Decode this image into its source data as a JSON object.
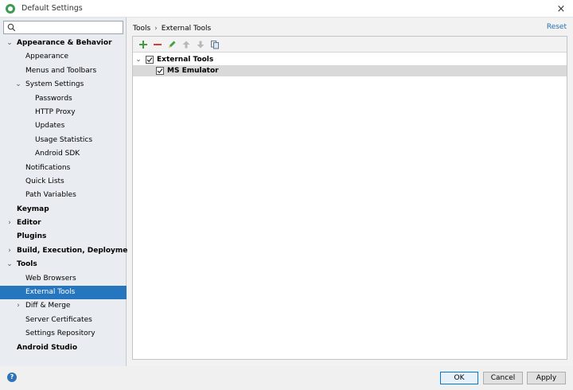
{
  "window": {
    "title": "Default Settings",
    "close_glyph": "×"
  },
  "search": {
    "value": "",
    "placeholder": ""
  },
  "sidebar": {
    "items": [
      {
        "label": "Appearance & Behavior",
        "level": 0,
        "bold": true,
        "arrow": "expanded"
      },
      {
        "label": "Appearance",
        "level": 2
      },
      {
        "label": "Menus and Toolbars",
        "level": 2
      },
      {
        "label": "System Settings",
        "level": 1,
        "arrow": "expanded"
      },
      {
        "label": "Passwords",
        "level": 3
      },
      {
        "label": "HTTP Proxy",
        "level": 3
      },
      {
        "label": "Updates",
        "level": 3
      },
      {
        "label": "Usage Statistics",
        "level": 3
      },
      {
        "label": "Android SDK",
        "level": 3
      },
      {
        "label": "Notifications",
        "level": 2
      },
      {
        "label": "Quick Lists",
        "level": 2
      },
      {
        "label": "Path Variables",
        "level": 2
      },
      {
        "label": "Keymap",
        "level": 0,
        "bold": true
      },
      {
        "label": "Editor",
        "level": 0,
        "bold": true,
        "arrow": "collapsed"
      },
      {
        "label": "Plugins",
        "level": 0,
        "bold": true
      },
      {
        "label": "Build, Execution, Deployment",
        "level": 0,
        "bold": true,
        "arrow": "collapsed"
      },
      {
        "label": "Tools",
        "level": 0,
        "bold": true,
        "arrow": "expanded"
      },
      {
        "label": "Web Browsers",
        "level": 2
      },
      {
        "label": "External Tools",
        "level": 2,
        "selected": true
      },
      {
        "label": "Diff & Merge",
        "level": 1,
        "arrow": "collapsed"
      },
      {
        "label": "Server Certificates",
        "level": 2
      },
      {
        "label": "Settings Repository",
        "level": 2
      },
      {
        "label": "Android Studio",
        "level": 0,
        "bold": true
      }
    ]
  },
  "breadcrumb": {
    "parent": "Tools",
    "separator": "›",
    "current": "External Tools"
  },
  "reset_label": "Reset",
  "toolbar": {
    "buttons": [
      {
        "name": "add-button",
        "icon": "plus-icon",
        "color": "#3c9f3c",
        "enabled": true
      },
      {
        "name": "remove-button",
        "icon": "minus-icon",
        "color": "#d93a3a",
        "enabled": true
      },
      {
        "name": "edit-button",
        "icon": "pencil-icon",
        "color": "#3fa04a",
        "enabled": true
      },
      {
        "name": "move-up-button",
        "icon": "arrow-up-icon",
        "color": "#b8b8b8",
        "enabled": false
      },
      {
        "name": "move-down-button",
        "icon": "arrow-down-icon",
        "color": "#b8b8b8",
        "enabled": false
      },
      {
        "name": "copy-button",
        "icon": "copy-icon",
        "color": "#5a7691",
        "enabled": true
      }
    ]
  },
  "tools_tree": {
    "group": {
      "label": "External Tools",
      "checked": true,
      "expanded": true
    },
    "items": [
      {
        "label": "MS Emulator",
        "checked": true,
        "highlighted": true
      }
    ]
  },
  "footer": {
    "help_glyph": "?",
    "ok_label": "OK",
    "cancel_label": "Cancel",
    "apply_label": "Apply"
  },
  "colors": {
    "selection": "#2675bf",
    "link": "#2470b3",
    "sidebar_bg": "#e9edf1",
    "row_highlight": "#d9d9d9"
  }
}
